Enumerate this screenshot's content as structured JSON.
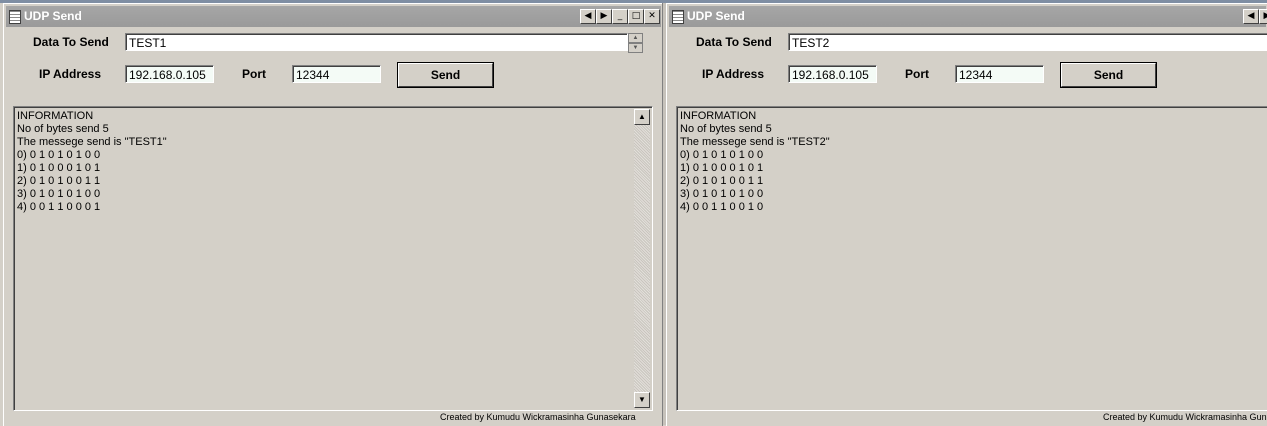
{
  "windows": [
    {
      "title": "UDP Send",
      "data_to_send_label": "Data To Send",
      "data_to_send_value": "TEST1",
      "ip_label": "IP Address",
      "ip_value": "192.168.0.105",
      "port_label": "Port",
      "port_value": "12344",
      "send_label": "Send",
      "info_text": "INFORMATION\nNo of bytes send 5\nThe messege send is \"TEST1\"\n0) 0 1 0 1 0 1 0 0\n1) 0 1 0 0 0 1 0 1\n2) 0 1 0 1 0 0 1 1\n3) 0 1 0 1 0 1 0 0\n4) 0 0 1 1 0 0 0 1",
      "credit": "Created by  Kumudu Wickramasinha Gunasekara"
    },
    {
      "title": "UDP Send",
      "data_to_send_label": "Data To Send",
      "data_to_send_value": "TEST2",
      "ip_label": "IP Address",
      "ip_value": "192.168.0.105",
      "port_label": "Port",
      "port_value": "12344",
      "send_label": "Send",
      "info_text": "INFORMATION\nNo of bytes send 5\nThe messege send is \"TEST2\"\n0) 0 1 0 1 0 1 0 0\n1) 0 1 0 0 0 1 0 1\n2) 0 1 0 1 0 0 1 1\n3) 0 1 0 1 0 1 0 0\n4) 0 0 1 1 0 0 1 0",
      "credit": "Created by  Kumudu Wickramasinha Gun"
    }
  ],
  "icons": {
    "prev": "◀",
    "next": "▶",
    "minimize": "_",
    "maximize": "□",
    "close": "✕",
    "scroll_up": "▲",
    "scroll_down": "▼",
    "spin_up": "▲",
    "spin_down": "▼"
  }
}
